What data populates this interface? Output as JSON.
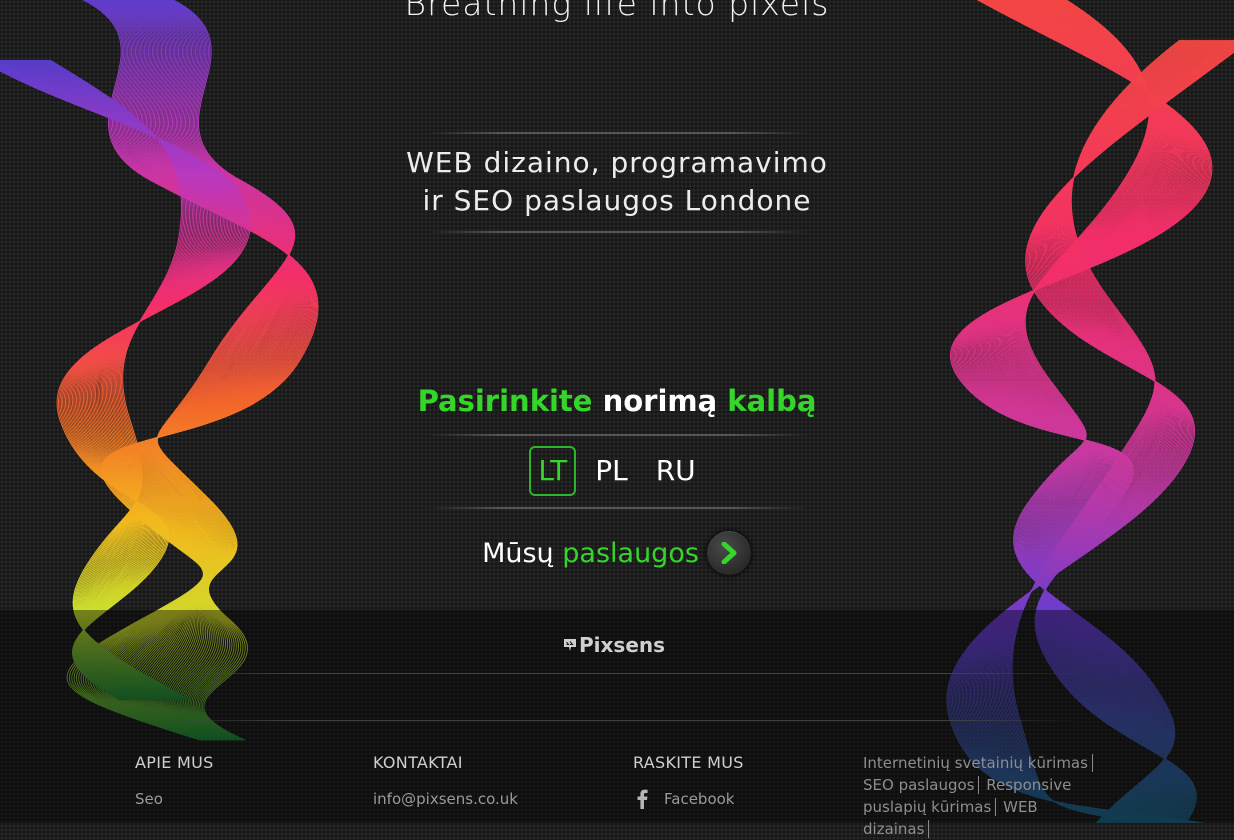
{
  "hero": {
    "title": "Breathing life into pixels",
    "subtitle_line1": "WEB dizaino, programavimo",
    "subtitle_line2": "ir SEO paslaugos Londone"
  },
  "language": {
    "heading_part1": "Pasirinkite",
    "heading_part2": "norimą",
    "heading_part3": "kalbą",
    "options": [
      "LT",
      "PL",
      "RU"
    ],
    "active": "LT"
  },
  "services": {
    "label_part1": "Mūsų",
    "label_part2": "paslaugos"
  },
  "footer": {
    "logo_text": "Pixsens",
    "about": {
      "title": "APIE MUS",
      "link": "Seo"
    },
    "contacts": {
      "title": "KONTAKTAI",
      "email": "info@pixsens.co.uk"
    },
    "find_us": {
      "title": "RASKITE MUS",
      "facebook": "Facebook"
    },
    "tags": [
      "Internetinių svetainių kūrimas",
      "SEO paslaugos",
      "Responsive puslapių kūrimas",
      "WEB dizainas"
    ]
  },
  "colors": {
    "accent_green": "#35d62a",
    "background": "#1f1f1f"
  },
  "icons": {
    "arrow": "chevron-right-icon",
    "facebook": "facebook-icon",
    "logo": "pixsens-logo-icon"
  }
}
